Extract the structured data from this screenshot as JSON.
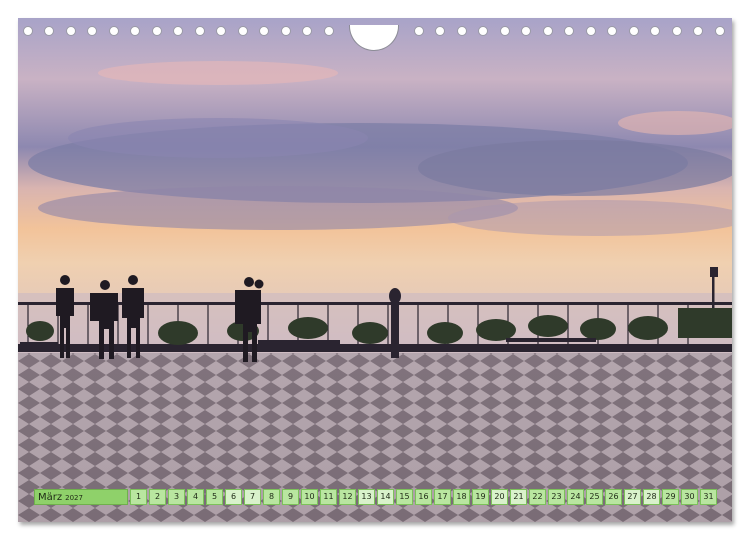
{
  "calendar": {
    "month": "März",
    "year": "2027",
    "days": [
      "1",
      "2",
      "3",
      "4",
      "5",
      "6",
      "7",
      "8",
      "9",
      "10",
      "11",
      "12",
      "13",
      "14",
      "15",
      "16",
      "17",
      "18",
      "19",
      "20",
      "21",
      "22",
      "23",
      "24",
      "25",
      "26",
      "27",
      "28",
      "29",
      "30",
      "31"
    ],
    "weekend_days": [
      "6",
      "7",
      "13",
      "14",
      "20",
      "21",
      "27",
      "28"
    ]
  },
  "colors": {
    "accent_green": "#8fd16a",
    "day_green": "#b9e6a0"
  }
}
